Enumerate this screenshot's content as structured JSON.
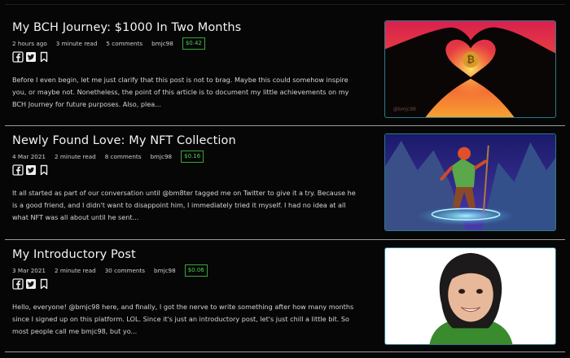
{
  "posts": [
    {
      "title": "My BCH Journey: $1000 In Two Months",
      "time": "2 hours ago",
      "read": "3 minute read",
      "comments": "5 comments",
      "author": "bmjc98",
      "tip": "$0.42",
      "excerpt": "Before I even begin, let me just clarify that this post is not to brag. Maybe this could somehow inspire you, or maybe not. Nonetheless, the point of this article is to document my little achievements on my BCH Journey for future purposes. Also, plea...",
      "thumb_watermark": "@bmjc98"
    },
    {
      "title": "Newly Found Love: My NFT Collection",
      "time": "4 Mar 2021",
      "read": "2 minute read",
      "comments": "8 comments",
      "author": "bmjc98",
      "tip": "$0.16",
      "excerpt": "It all started as part of our conversation until @bm8ter tagged me on Twitter to give it a try. Because he is a good friend, and I didn't want to disappoint him, I immediately tried it myself. I had no idea at all what NFT was all about until he sent..."
    },
    {
      "title": "My Introductory Post",
      "time": "3 Mar 2021",
      "read": "2 minute read",
      "comments": "30 comments",
      "author": "bmjc98",
      "tip": "$0.06",
      "excerpt": "Hello, everyone!  @bmjc98 here, and finally, I got the nerve to write something after how many months since I signed up on this platform. LOL. Since it's just an introductory post, let's just chill a little bit.  So most people call me bmjc98, but yo..."
    }
  ],
  "icons": [
    "facebook-icon",
    "twitter-icon",
    "bookmark-icon"
  ],
  "colors": {
    "background": "#060606",
    "tip_green": "#4fd04f",
    "thumb_border": "#2a7a8a"
  }
}
